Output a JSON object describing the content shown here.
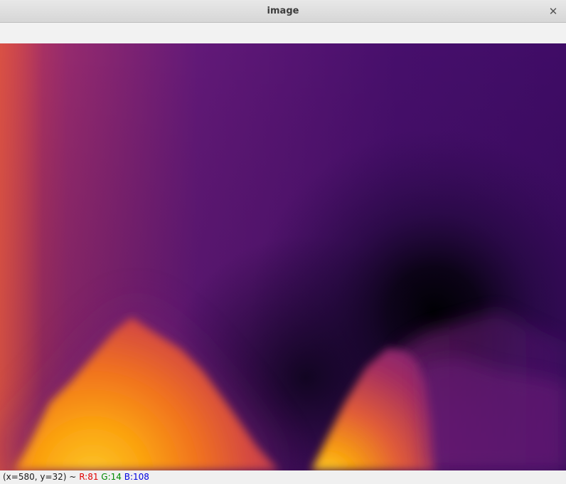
{
  "window": {
    "title": "image",
    "close_symbol": "✕"
  },
  "status": {
    "coords": "(x=580, y=32) ~",
    "r": "R:81",
    "g": "G:14",
    "b": "B:108",
    "r_color": "#e00000",
    "g_color": "#008a00",
    "b_color": "#0000e0"
  },
  "canvas": {
    "colormap": "inferno",
    "colors": {
      "dark": "#000004",
      "deep_purple": "#3b0f70",
      "purple": "#5a167e",
      "magenta": "#8c2981",
      "red": "#d44842",
      "orange": "#f98e09",
      "yellow": "#fcd225"
    }
  }
}
